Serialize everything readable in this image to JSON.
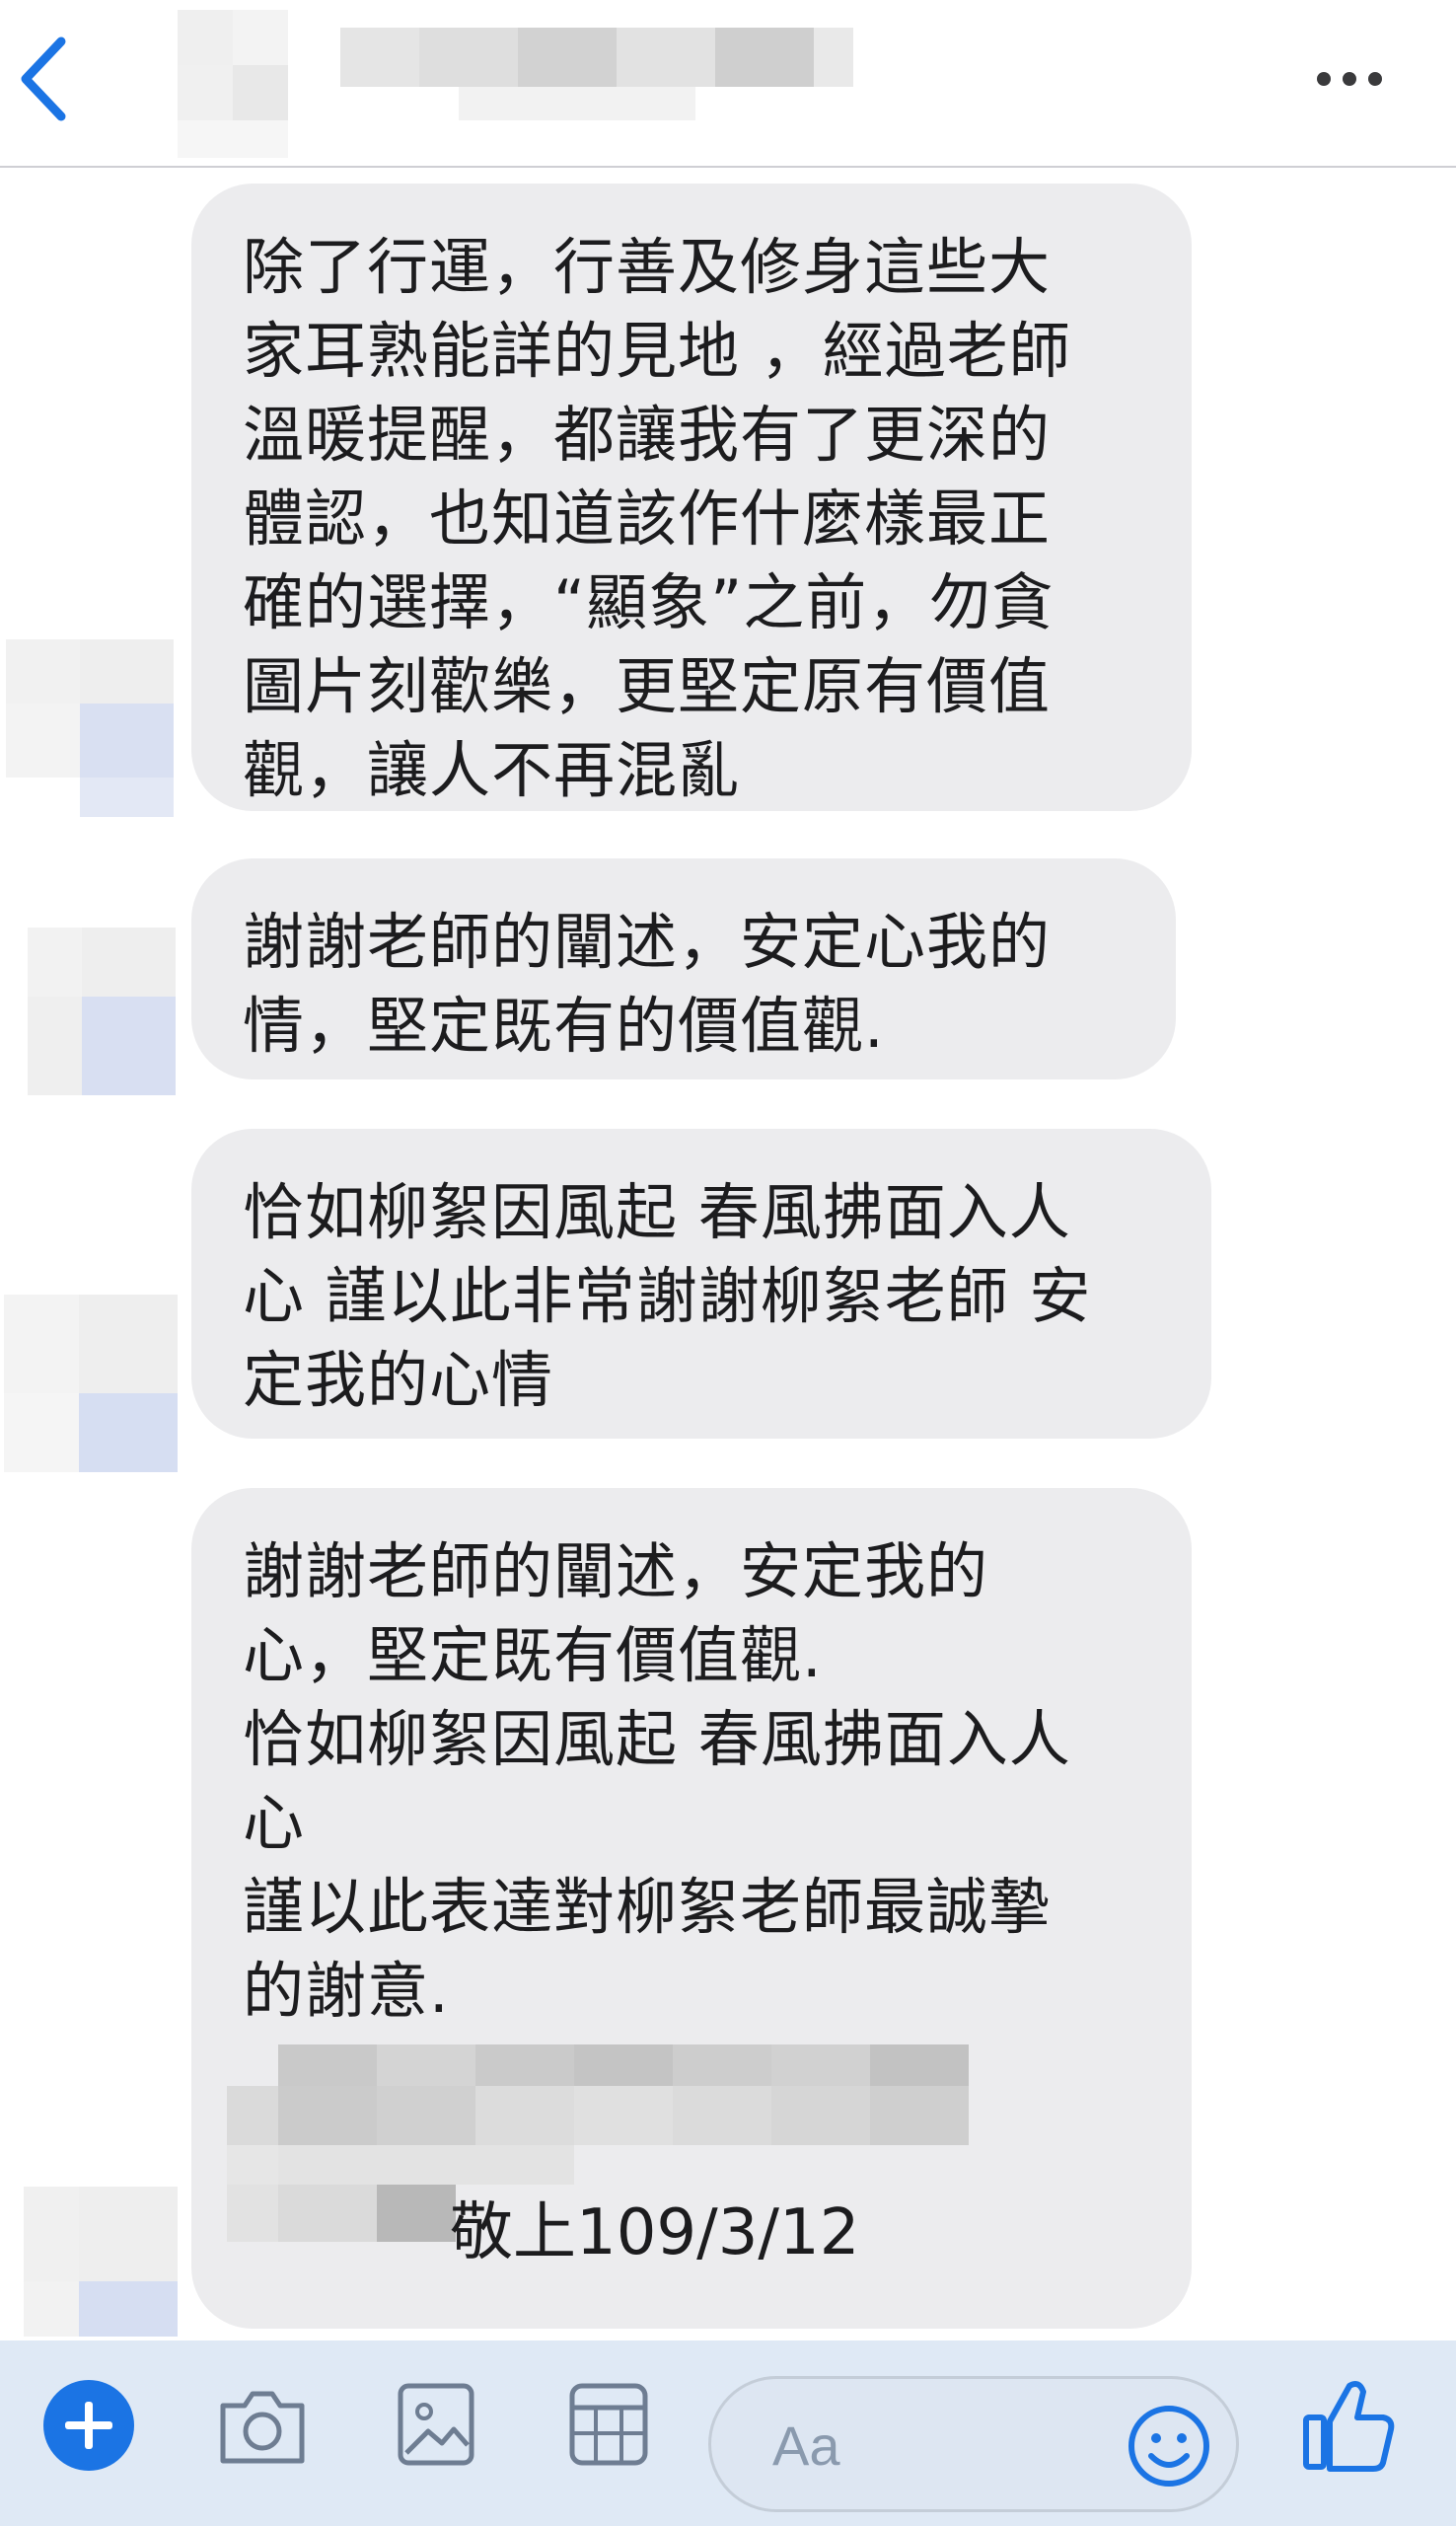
{
  "header": {
    "back": "back",
    "more": "more",
    "contact_name": ""
  },
  "messages": [
    {
      "text": "除了行運，行善及修身這些大\n家耳熟能詳的見地 ，經過老師\n溫暖提醒，都讓我有了更深的\n體認，也知道該作什麼樣最正\n確的選擇，“顯象”之前，勿貪\n圖片刻歡樂，更堅定原有價值\n觀，讓人不再混亂"
    },
    {
      "text": "謝謝老師的闡述，安定心我的\n情，堅定既有的價值觀."
    },
    {
      "text": "恰如柳絮因風起 春風拂面入人\n心 謹以此非常謝謝柳絮老師 安\n定我的心情"
    },
    {
      "text": "謝謝老師的闡述，安定我的\n心，堅定既有價值觀.\n恰如柳絮因風起 春風拂面入人\n心\n謹以此表達對柳絮老師最誠摯\n的謝意.",
      "signature": "敬上109/3/12"
    }
  ],
  "composer": {
    "placeholder": "Aa",
    "icons": [
      "plus-icon",
      "camera-icon",
      "gallery-icon",
      "sticker-icon",
      "emoji-icon",
      "like-icon"
    ]
  },
  "colors": {
    "accent": "#1b74e4",
    "bubble": "#ececee",
    "composer_bg": "#dfe9f5"
  }
}
